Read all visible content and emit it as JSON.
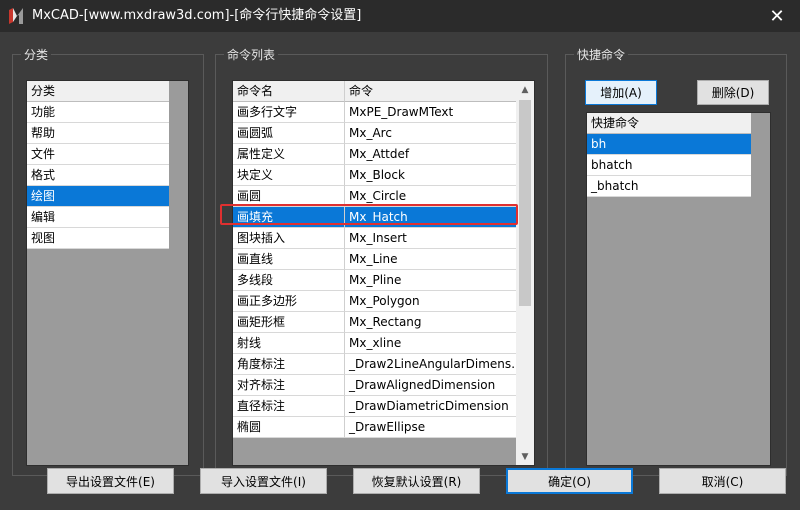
{
  "window": {
    "title": "MxCAD-[www.mxdraw3d.com]-[命令行快捷命令设置]",
    "close_glyph": "✕"
  },
  "category_group": {
    "label": "分类",
    "header": "分类",
    "items": [
      "功能",
      "帮助",
      "文件",
      "格式",
      "绘图",
      "编辑",
      "视图"
    ],
    "selected_index": 4
  },
  "command_group": {
    "label": "命令列表",
    "columns": [
      "命令名",
      "命令"
    ],
    "rows": [
      [
        "画多行文字",
        "MxPE_DrawMText"
      ],
      [
        "画圆弧",
        "Mx_Arc"
      ],
      [
        "属性定义",
        "Mx_Attdef"
      ],
      [
        "块定义",
        "Mx_Block"
      ],
      [
        "画圆",
        "Mx_Circle"
      ],
      [
        "画填充",
        "Mx_Hatch"
      ],
      [
        "图块插入",
        "Mx_Insert"
      ],
      [
        "画直线",
        "Mx_Line"
      ],
      [
        "多线段",
        "Mx_Pline"
      ],
      [
        "画正多边形",
        "Mx_Polygon"
      ],
      [
        "画矩形框",
        "Mx_Rectang"
      ],
      [
        "射线",
        "Mx_xline"
      ],
      [
        "角度标注",
        "_Draw2LineAngularDimens…"
      ],
      [
        "对齐标注",
        "_DrawAlignedDimension"
      ],
      [
        "直径标注",
        "_DrawDiametricDimension"
      ],
      [
        "椭圆",
        "_DrawEllipse"
      ]
    ],
    "selected_index": 5
  },
  "shortcut_group": {
    "label": "快捷命令",
    "add_button": "增加(A)",
    "delete_button": "删除(D)",
    "header": "快捷命令",
    "items": [
      "bh",
      "bhatch",
      "_bhatch"
    ],
    "selected_index": 0
  },
  "footer": {
    "export_button": "导出设置文件(E)",
    "import_button": "导入设置文件(I)",
    "restore_button": "恢复默认设置(R)",
    "ok_button": "确定(O)",
    "cancel_button": "取消(C)"
  },
  "colors": {
    "selection": "#0a78d7",
    "highlight_box": "#e03030",
    "background": "#3c3c3c"
  }
}
